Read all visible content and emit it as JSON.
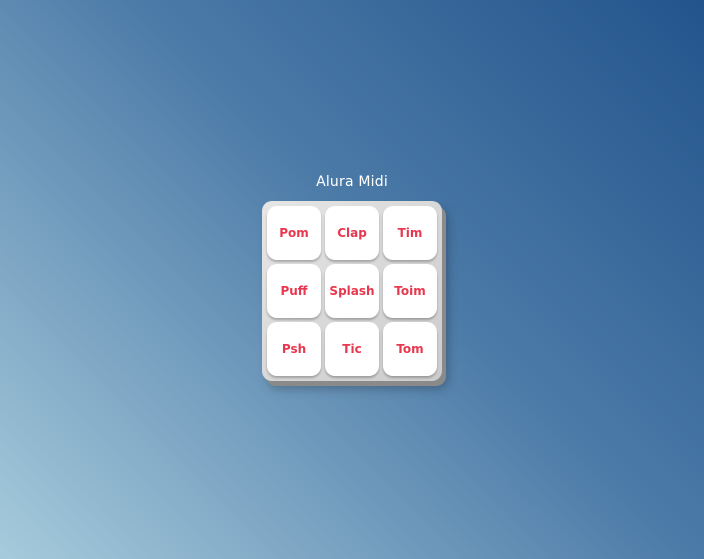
{
  "app": {
    "title": "Alura Midi"
  },
  "pads": [
    {
      "label": "Pom"
    },
    {
      "label": "Clap"
    },
    {
      "label": "Tim"
    },
    {
      "label": "Puff"
    },
    {
      "label": "Splash"
    },
    {
      "label": "Toim"
    },
    {
      "label": "Psh"
    },
    {
      "label": "Tic"
    },
    {
      "label": "Tom"
    }
  ],
  "colors": {
    "pad_text": "#e8384f",
    "pad_background": "#ffffff",
    "board_background": "#dcdcdc",
    "page_gradient_dark": "#23548c",
    "page_gradient_light": "#a6cbdc"
  }
}
